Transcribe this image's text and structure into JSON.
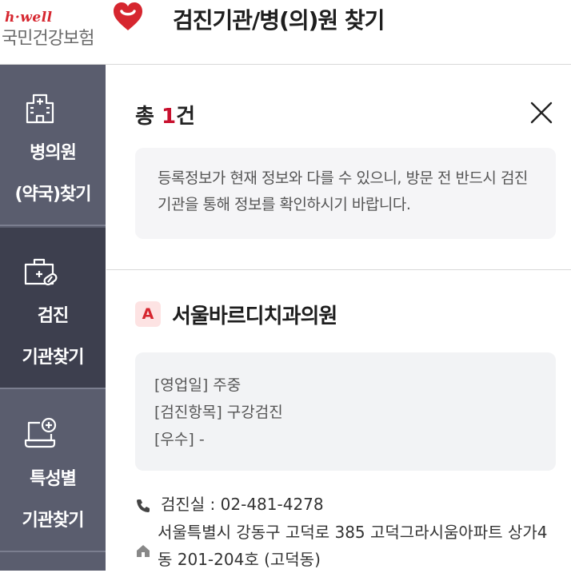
{
  "header": {
    "logo_hwell": "h·well",
    "logo_name": "국민건강보험",
    "title": "검진기관/병(의)원 찾기"
  },
  "sidebar": {
    "items": [
      {
        "line1": "병의원",
        "line2": "(약국)찾기",
        "icon": "hospital-icon",
        "active": false
      },
      {
        "line1": "검진",
        "line2": "기관찾기",
        "icon": "medical-kit-icon",
        "active": true
      },
      {
        "line1": "특성별",
        "line2": "기관찾기",
        "icon": "laptop-plus-icon",
        "active": false
      }
    ]
  },
  "results": {
    "count_prefix": "총 ",
    "count": "1",
    "count_suffix": "건",
    "notice": "등록정보가 현재 정보와 다를 수 있으니, 방문 전 반드시 검진기관을 통해 정보를 확인하시기 바랍니다."
  },
  "hospital": {
    "badge": "A",
    "name": "서울바르디치과의원",
    "info": [
      "[영업일] 주중",
      "[검진항목] 구강검진",
      "[우수] -"
    ],
    "phone_label": "검진실 : ",
    "phone": "02-481-4278",
    "address": "서울특별시 강동구 고덕로 385 고덕그라시움아파트 상가4동 201-204호 (고덕동)"
  },
  "colors": {
    "accent": "#c8102e",
    "sidebar": "#5a5d6e",
    "sidebar_active": "#3d3f4e"
  }
}
